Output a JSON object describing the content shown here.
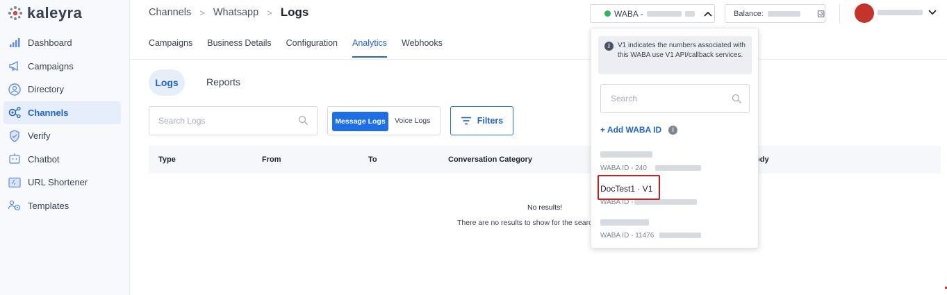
{
  "brand": {
    "name": "kaleyra",
    "accent": "#1e63d8",
    "logo_color": "#d0474f"
  },
  "sidebar": {
    "items": [
      {
        "label": "Dashboard",
        "icon": "bar-chart-icon",
        "active": false
      },
      {
        "label": "Campaigns",
        "icon": "megaphone-icon",
        "active": false
      },
      {
        "label": "Directory",
        "icon": "contact-icon",
        "active": false
      },
      {
        "label": "Channels",
        "icon": "channels-icon",
        "active": true
      },
      {
        "label": "Verify",
        "icon": "shield-check-icon",
        "active": false
      },
      {
        "label": "Chatbot",
        "icon": "chatbot-icon",
        "active": false
      },
      {
        "label": "URL Shortener",
        "icon": "link-icon",
        "active": false
      },
      {
        "label": "Templates",
        "icon": "templates-icon",
        "active": false
      }
    ]
  },
  "breadcrumb": {
    "items": [
      "Channels",
      "Whatsapp"
    ],
    "current": "Logs"
  },
  "header": {
    "waba_label": "WABA -",
    "balance_label": "Balance:"
  },
  "tabs": [
    "Campaigns",
    "Business Details",
    "Configuration",
    "Analytics",
    "Webhooks"
  ],
  "active_tab": "Analytics",
  "subtabs": {
    "logs": "Logs",
    "reports": "Reports"
  },
  "search": {
    "placeholder": "Search Logs"
  },
  "log_toggle": {
    "message": "Message Logs",
    "voice": "Voice Logs"
  },
  "filters_label": "Filters",
  "table": {
    "columns": [
      "Type",
      "From",
      "To",
      "Conversation Category",
      "ody"
    ],
    "empty_title": "No results!",
    "empty_sub": "There are no results to show for the searc"
  },
  "dropdown": {
    "info": "V1 indicates the numbers associated with this WABA use V1 API/callback services.",
    "search_placeholder": "Search",
    "add_label": "+ Add WABA ID",
    "items": [
      {
        "name": "",
        "sub": "WABA ID - 240"
      },
      {
        "name": "DocTest1 · V1",
        "sub": "WABA ID -"
      },
      {
        "name": "",
        "sub": "WABA ID - 11476"
      }
    ]
  }
}
